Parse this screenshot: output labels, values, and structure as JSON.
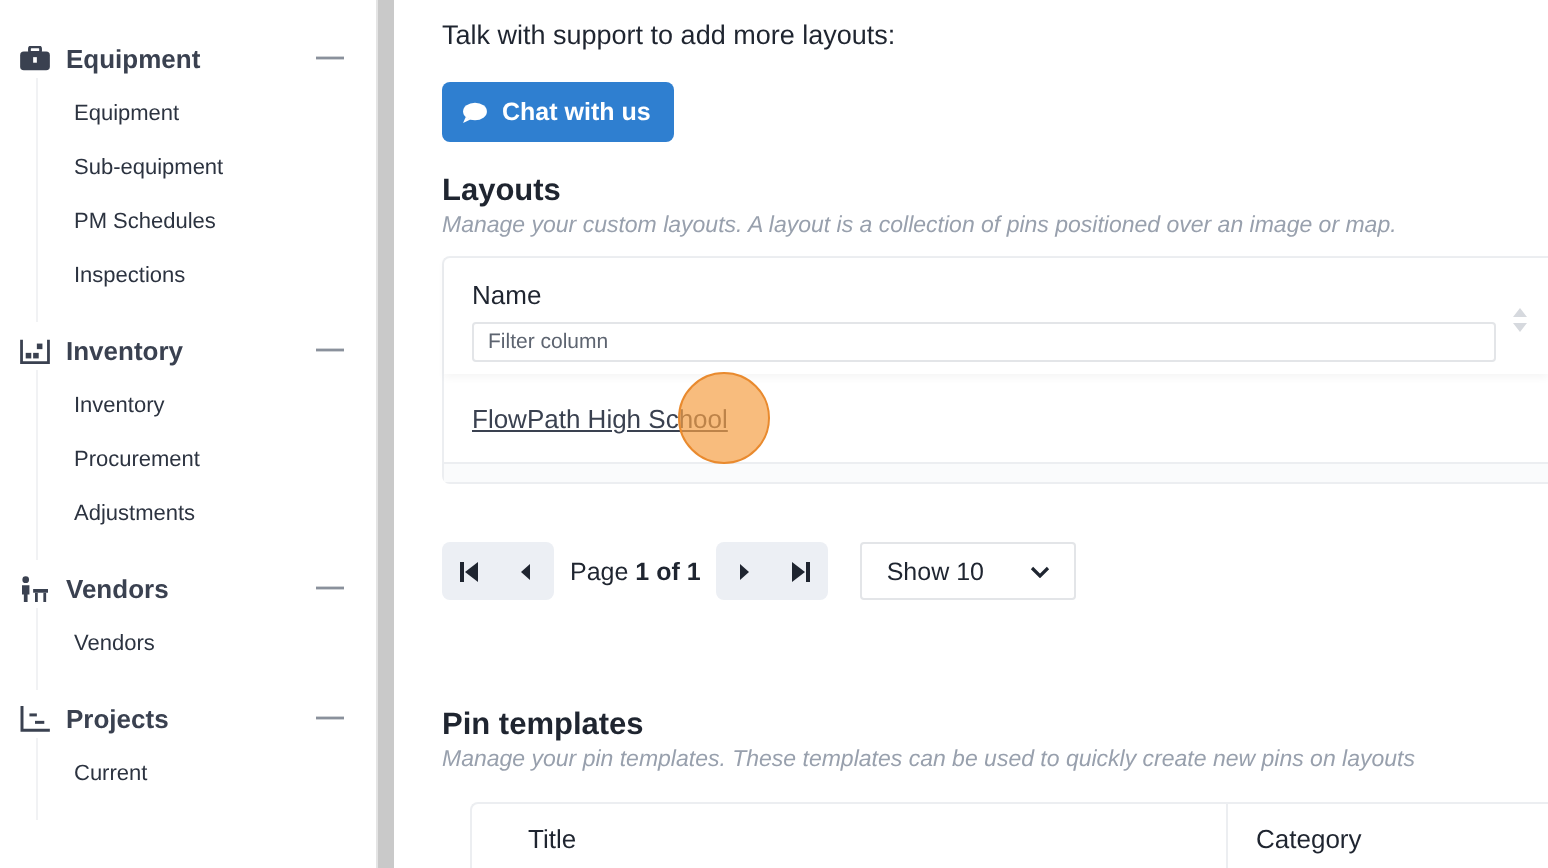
{
  "sidebar": {
    "sections": [
      {
        "kind": "equipment",
        "label": "Equipment",
        "expanded": true,
        "items": [
          "Equipment",
          "Sub-equipment",
          "PM Schedules",
          "Inspections"
        ]
      },
      {
        "kind": "inventory",
        "label": "Inventory",
        "expanded": true,
        "items": [
          "Inventory",
          "Procurement",
          "Adjustments"
        ]
      },
      {
        "kind": "vendors",
        "label": "Vendors",
        "expanded": true,
        "items": [
          "Vendors"
        ]
      },
      {
        "kind": "projects",
        "label": "Projects",
        "expanded": true,
        "items": [
          "Current"
        ]
      }
    ]
  },
  "support": {
    "text": "Talk with support to add more layouts:",
    "button": "Chat with us"
  },
  "layouts": {
    "title": "Layouts",
    "description": "Manage your custom layouts. A layout is a collection of pins positioned over an image or map.",
    "table": {
      "column": "Name",
      "filter_placeholder": "Filter column",
      "rows": [
        "FlowPath High School"
      ]
    },
    "pagination": {
      "page": "Page **1 of 1**",
      "page_size": "Show 10"
    }
  },
  "pin_templates": {
    "title": "Pin templates",
    "description": "Manage your pin templates. These templates can be used to quickly create new pins on layouts",
    "columns": [
      "Title",
      "Category"
    ]
  }
}
